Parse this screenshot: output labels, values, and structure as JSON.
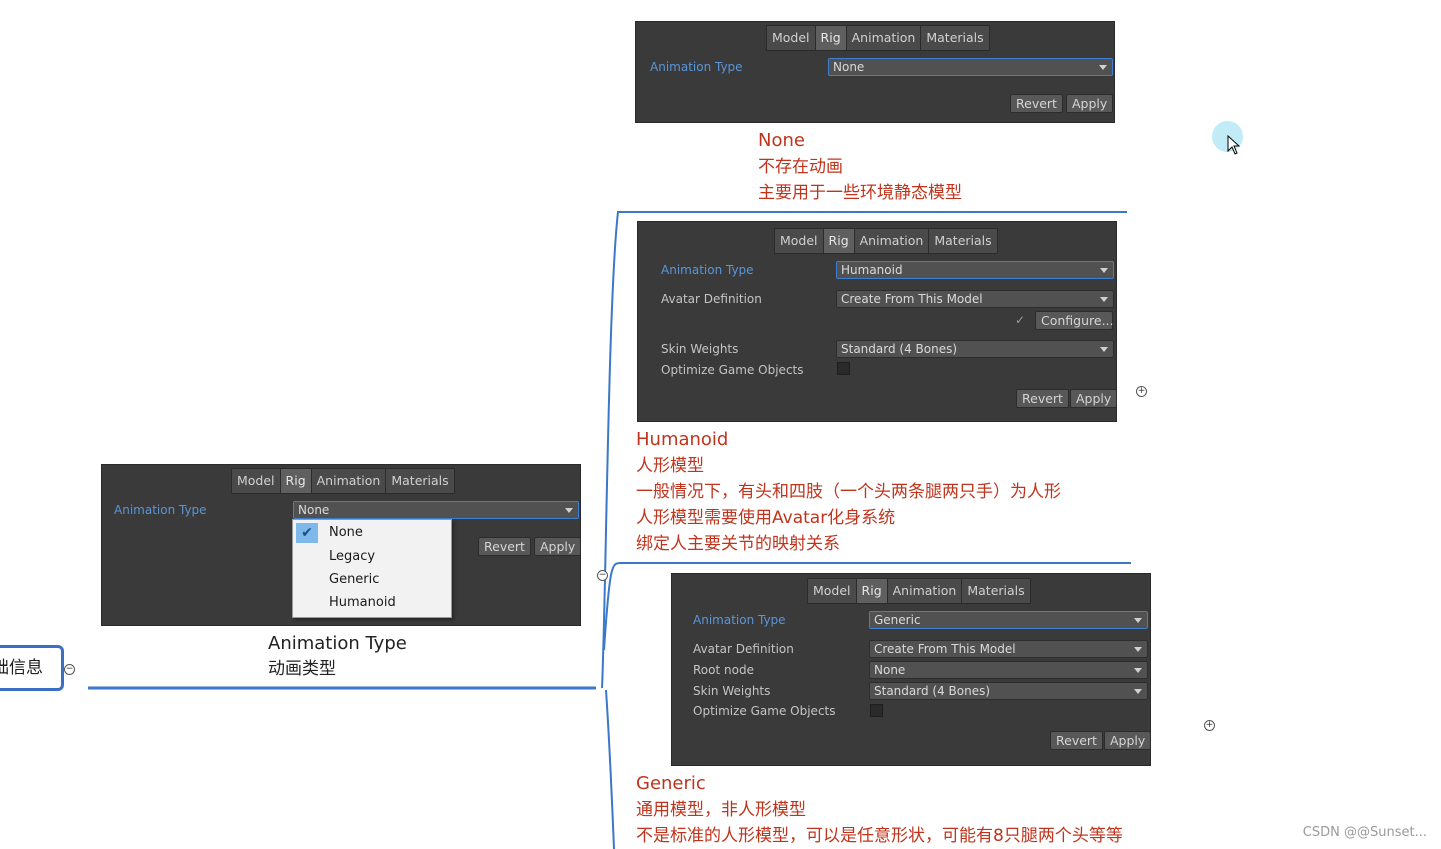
{
  "tabs": [
    "Model",
    "Rig",
    "Animation",
    "Materials"
  ],
  "labels": {
    "animation_type": "Animation Type",
    "avatar_definition": "Avatar Definition",
    "root_node": "Root node",
    "skin_weights": "Skin Weights",
    "optimize_game_objects": "Optimize Game Objects"
  },
  "buttons": {
    "revert": "Revert",
    "apply": "Apply",
    "configure": "Configure..."
  },
  "panels": {
    "none": {
      "animation_type": "None"
    },
    "humanoid": {
      "animation_type": "Humanoid",
      "avatar_definition": "Create From This Model",
      "skin_weights": "Standard (4 Bones)",
      "optimize_game_objects": false
    },
    "generic": {
      "animation_type": "Generic",
      "avatar_definition": "Create From This Model",
      "root_node": "None",
      "skin_weights": "Standard (4 Bones)",
      "optimize_game_objects": false
    },
    "main": {
      "animation_type": "None",
      "menu_options": [
        "None",
        "Legacy",
        "Generic",
        "Humanoid"
      ],
      "menu_selected": "None"
    }
  },
  "mindmap": {
    "root": "础信息",
    "branch": {
      "title": "Animation Type",
      "subtitle": "动画类型"
    },
    "none": {
      "title": "None",
      "lines": [
        "不存在动画",
        "主要用于一些环境静态模型"
      ]
    },
    "humanoid": {
      "title": "Humanoid",
      "lines": [
        "人形模型",
        "一般情况下，有头和四肢（一个头两条腿两只手）为人形",
        "人形模型需要使用Avatar化身系统",
        "绑定人主要关节的映射关系"
      ]
    },
    "generic": {
      "title": "Generic",
      "lines": [
        "通用模型，非人形模型",
        "不是标准的人形模型，可以是任意形状，可能有8只腿两个头等等"
      ]
    }
  },
  "colors": {
    "note_red": "#c0341d",
    "connector_blue": "#3b78c9",
    "panel_bg": "#3a3a3a",
    "label_blue": "#5a95d8"
  },
  "watermark": "CSDN @@Sunset..."
}
